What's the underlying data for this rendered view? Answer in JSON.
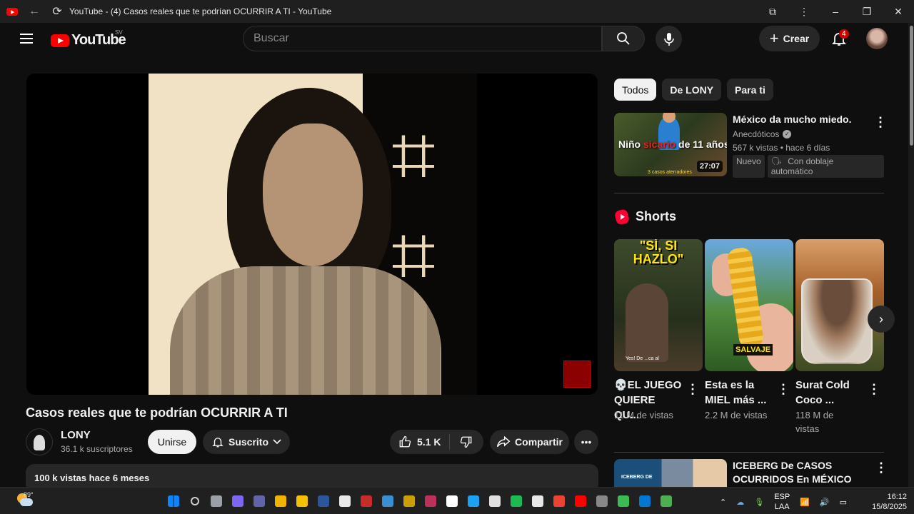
{
  "window": {
    "title": "YouTube - (4) Casos reales que te podrían OCURRIR A TI - YouTube",
    "controls": [
      "–",
      "❐",
      "✕"
    ]
  },
  "header": {
    "logo_text": "YouTube",
    "region": "SV",
    "search_placeholder": "Buscar",
    "create_label": "Crear",
    "notification_count": "4"
  },
  "video": {
    "title": "Casos reales que te podrían OCURRIR A TI",
    "channel_name": "LONY",
    "channel_subs": "36.1 k suscriptores",
    "join_label": "Unirse",
    "subscribed_label": "Suscrito",
    "likes": "5.1 K",
    "share_label": "Compartir",
    "views_and_age": "100 k vistas  hace 6 meses"
  },
  "sidebar": {
    "chips": [
      "Todos",
      "De LONY",
      "Para ti"
    ],
    "active_chip": "Todos",
    "recommended": [
      {
        "title": "México da mucho miedo.",
        "channel": "Anecdóticos",
        "meta": "567 k vistas • hace 6 días",
        "tags": [
          "Nuevo",
          "Con doblaje automático"
        ],
        "duration": "27:07",
        "thumb_text_a": "Niño ",
        "thumb_text_b": "sicario",
        "thumb_text_c": " de 11 años",
        "thumb_sub": "3 casos aterradores"
      },
      {
        "title": "ICEBERG De CASOS OCURRIDOS En MÉXICO",
        "thumb_text": "ICEBERG DE"
      }
    ],
    "shorts_label": "Shorts",
    "shorts": [
      {
        "caption": "\"SÍ, SI HAZLO\"",
        "title": "💀EL JUEGO QUIERE QU...",
        "views": "11 M de vistas",
        "small": "Yes! De ...ca al"
      },
      {
        "caption": "SALVAJE",
        "title": "Esta es la MIEL más ...",
        "views": "2.2 M de vistas"
      },
      {
        "title": "Surat Cold Coco ...",
        "views": "118 M de vistas"
      }
    ]
  },
  "taskbar": {
    "temperature": "89°",
    "lang_line1": "ESP",
    "lang_line2": "LAA",
    "time": "16:12",
    "date": "15/8/2025"
  },
  "icons": {
    "colors": [
      "#0a84ff",
      "#cfcfcf",
      "#9aa0a6",
      "#7b68ee",
      "#6264a7",
      "#f0b400",
      "#f5c000",
      "#2b579a",
      "#e8e8e8",
      "#c72c2c",
      "#3b8ed0",
      "#c8a000",
      "#b8325a",
      "#ffffff",
      "#1da1f2",
      "#e0e0e0",
      "#1db954",
      "#e8e8e8",
      "#ea4335",
      "#ff0000",
      "#888888",
      "#3cba54",
      "#0078d4",
      "#4caf50"
    ]
  }
}
